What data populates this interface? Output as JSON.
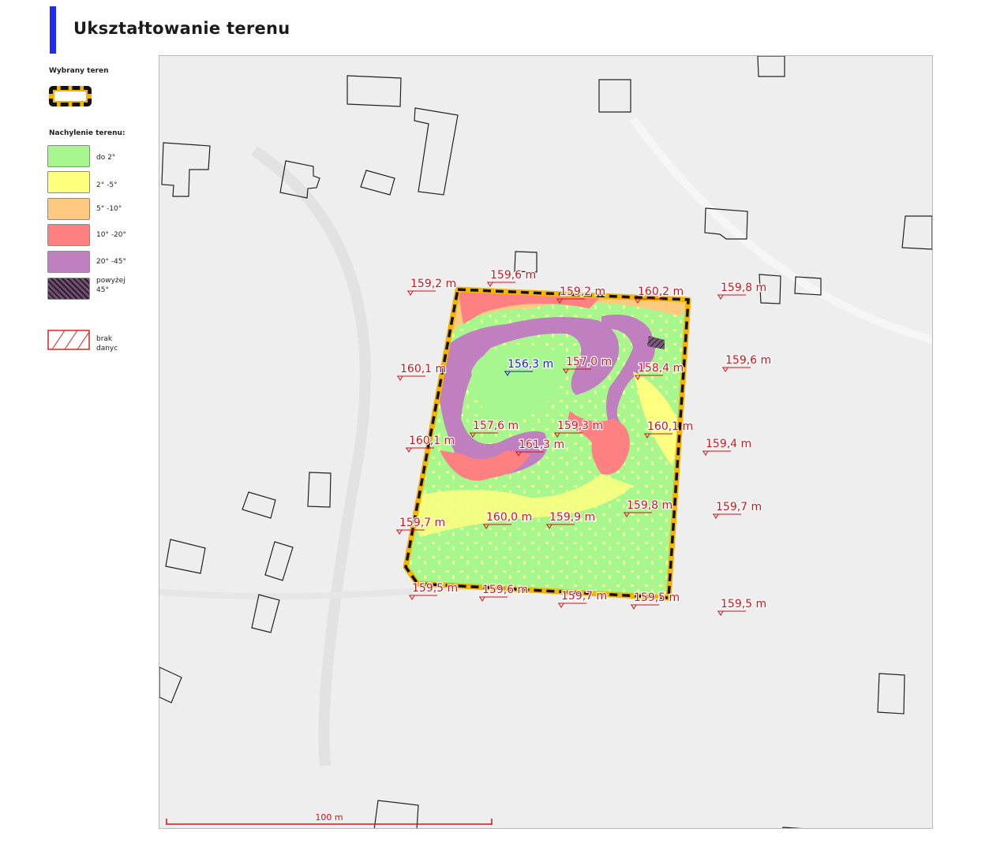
{
  "title": "Ukształtowanie terenu",
  "colors": {
    "accent": "#1f2cf3",
    "selection_fill": "#f4b400",
    "selection_dash": "#111111",
    "label_red": "#d0141a",
    "label_blue": "#1a1ad0",
    "building_outline": "#222222"
  },
  "legend": {
    "selected_heading": "Wybrany teren",
    "slope_heading": "Nachylenie terenu:",
    "items": [
      {
        "label": "do 2°",
        "color": "#a6f78e",
        "pattern": "solid"
      },
      {
        "label": "2° -5°",
        "color": "#ffff80",
        "pattern": "solid"
      },
      {
        "label": "5° -10°",
        "color": "#ffc980",
        "pattern": "solid"
      },
      {
        "label": "10° -20°",
        "color": "#ff8080",
        "pattern": "solid"
      },
      {
        "label": "20° -45°",
        "color": "#c080c0",
        "pattern": "solid"
      },
      {
        "label": "powyżej 45°",
        "color": "#705070",
        "pattern": "hatched"
      }
    ],
    "nodata_label": "brak danyc"
  },
  "map": {
    "scale_label": "100 m",
    "elevations": [
      {
        "value": "159,2 m",
        "color": "red"
      },
      {
        "value": "159,6 m",
        "color": "red"
      },
      {
        "value": "159,2 m",
        "color": "red"
      },
      {
        "value": "160,2 m",
        "color": "red"
      },
      {
        "value": "159,8 m",
        "color": "red"
      },
      {
        "value": "160,1 m",
        "color": "red"
      },
      {
        "value": "156,3 m",
        "color": "blue"
      },
      {
        "value": "157,0 m",
        "color": "red"
      },
      {
        "value": "158,4 m",
        "color": "red"
      },
      {
        "value": "159,6 m",
        "color": "red"
      },
      {
        "value": "160,1 m",
        "color": "red"
      },
      {
        "value": "157,6 m",
        "color": "red"
      },
      {
        "value": "159,3 m",
        "color": "red"
      },
      {
        "value": "160,1 m",
        "color": "red"
      },
      {
        "value": "159,4 m",
        "color": "red"
      },
      {
        "value": "161,3 m",
        "color": "red"
      },
      {
        "value": "159,7 m",
        "color": "red"
      },
      {
        "value": "160,0 m",
        "color": "red"
      },
      {
        "value": "159,9 m",
        "color": "red"
      },
      {
        "value": "159,8 m",
        "color": "red"
      },
      {
        "value": "159,7 m",
        "color": "red"
      },
      {
        "value": "159,5 m",
        "color": "red"
      },
      {
        "value": "159,6 m",
        "color": "red"
      },
      {
        "value": "159,7 m",
        "color": "red"
      },
      {
        "value": "159,5 m",
        "color": "red"
      },
      {
        "value": "159,5 m",
        "color": "red"
      }
    ]
  }
}
